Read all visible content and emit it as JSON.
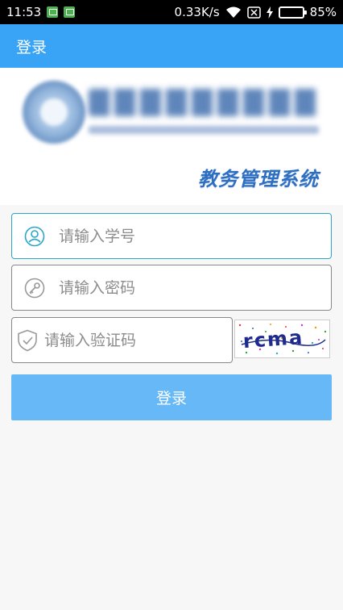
{
  "status_bar": {
    "time": "11:53",
    "net_speed": "0.33K/s",
    "battery_percent": "85%",
    "battery_level": 0.85
  },
  "app_bar": {
    "title": "登录"
  },
  "header": {
    "system_title": "教务管理系统"
  },
  "form": {
    "student_id": {
      "placeholder": "请输入学号",
      "value": ""
    },
    "password": {
      "placeholder": "请输入密码",
      "value": ""
    },
    "captcha": {
      "placeholder": "请输入验证码",
      "value": ""
    },
    "captcha_image_text": "rcma",
    "submit_label": "登录"
  },
  "colors": {
    "app_bar": "#39a3f5",
    "button": "#66b9f6",
    "active_border": "#2aa6c9",
    "battery": "#8bd34a"
  }
}
